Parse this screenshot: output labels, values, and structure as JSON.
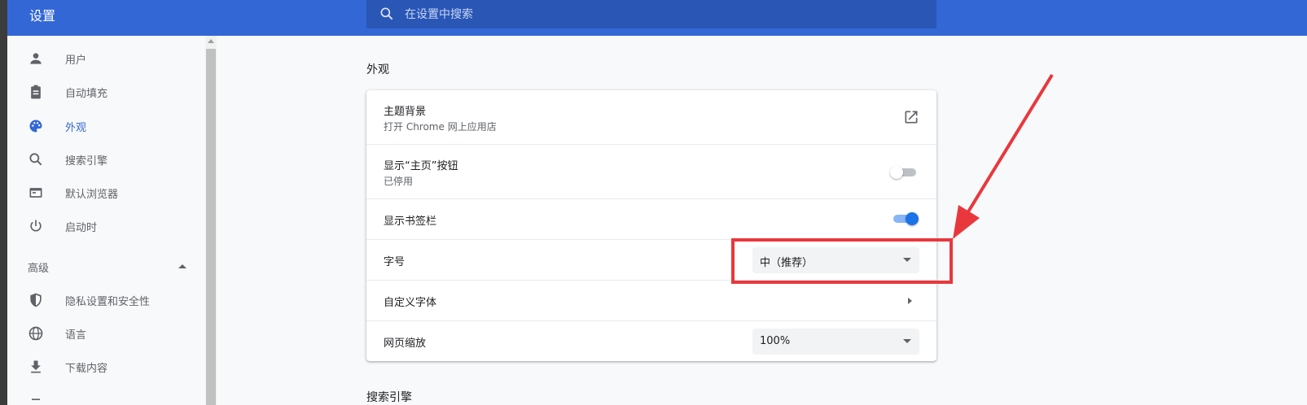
{
  "header": {
    "title": "设置",
    "search_placeholder": "在设置中搜索"
  },
  "sidebar": {
    "items": [
      {
        "label": "用户",
        "icon": "person-icon"
      },
      {
        "label": "自动填充",
        "icon": "clipboard-icon"
      },
      {
        "label": "外观",
        "icon": "palette-icon",
        "active": true
      },
      {
        "label": "搜索引擎",
        "icon": "search-icon"
      },
      {
        "label": "默认浏览器",
        "icon": "browser-icon"
      },
      {
        "label": "启动时",
        "icon": "power-icon"
      }
    ],
    "advanced_label": "高级",
    "advanced_items": [
      {
        "label": "隐私设置和安全性",
        "icon": "shield-icon"
      },
      {
        "label": "语言",
        "icon": "globe-icon"
      },
      {
        "label": "下载内容",
        "icon": "download-icon"
      }
    ]
  },
  "main": {
    "section_title": "外观",
    "rows": {
      "theme": {
        "title": "主题背景",
        "subtitle": "打开 Chrome 网上应用店"
      },
      "home_button": {
        "title": "显示“主页”按钮",
        "subtitle": "已停用",
        "enabled": false
      },
      "bookmarks_bar": {
        "title": "显示书签栏",
        "enabled": true
      },
      "font_size": {
        "title": "字号",
        "value": "中（推荐）"
      },
      "custom_fonts": {
        "title": "自定义字体"
      },
      "page_zoom": {
        "title": "网页缩放",
        "value": "100%"
      }
    },
    "next_section_title": "搜索引擎"
  },
  "colors": {
    "accent": "#3367d6",
    "toggle_on": "#1a73e8",
    "annotation": "#e8383d"
  }
}
